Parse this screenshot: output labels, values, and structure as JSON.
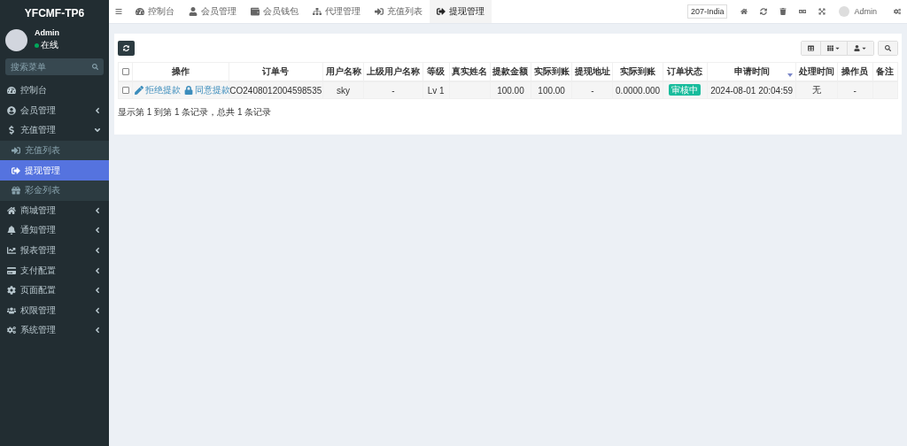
{
  "brand": "YFCMF-TP6",
  "user": {
    "name": "Admin",
    "status": "在线",
    "online": true
  },
  "search": {
    "placeholder": "搜索菜单"
  },
  "sidebar": {
    "items": [
      {
        "label": "控制台",
        "selected": false
      },
      {
        "label": "会员管理",
        "selected": false,
        "expanded": false
      },
      {
        "label": "充值管理",
        "selected": false,
        "expanded": true,
        "children": [
          {
            "label": "充值列表",
            "selected": false
          },
          {
            "label": "提现管理",
            "selected": true
          },
          {
            "label": "彩金列表",
            "selected": false
          }
        ]
      },
      {
        "label": "商城管理",
        "selected": false,
        "expanded": false
      },
      {
        "label": "通知管理",
        "selected": false,
        "expanded": false
      },
      {
        "label": "报表管理",
        "selected": false,
        "expanded": false
      },
      {
        "label": "支付配置",
        "selected": false,
        "expanded": false
      },
      {
        "label": "页面配置",
        "selected": false,
        "expanded": false
      },
      {
        "label": "权限管理",
        "selected": false,
        "expanded": false
      },
      {
        "label": "系统管理",
        "selected": false,
        "expanded": false
      }
    ]
  },
  "tabs": [
    {
      "label": "控制台",
      "selected": false
    },
    {
      "label": "会员管理",
      "selected": false
    },
    {
      "label": "会员钱包",
      "selected": false
    },
    {
      "label": "代理管理",
      "selected": false
    },
    {
      "label": "充值列表",
      "selected": false
    },
    {
      "label": "提现管理",
      "selected": true
    }
  ],
  "header": {
    "site_badge": "207-India",
    "admin": "Admin"
  },
  "table": {
    "select_all": false,
    "columns": [
      {
        "label": "操作",
        "sorted": false
      },
      {
        "label": "订单号",
        "sorted": false
      },
      {
        "label": "用户名称",
        "sorted": false
      },
      {
        "label": "上级用户名称",
        "sorted": false
      },
      {
        "label": "等级",
        "sorted": false
      },
      {
        "label": "真实姓名",
        "sorted": false
      },
      {
        "label": "提款金额",
        "sorted": false
      },
      {
        "label": "实际到账",
        "sorted": false
      },
      {
        "label": "提现地址",
        "sorted": false
      },
      {
        "label": "实际到账",
        "sorted": false
      },
      {
        "label": "订单状态",
        "sorted": false
      },
      {
        "label": "申请时间",
        "sorted": true
      },
      {
        "label": "处理时间",
        "sorted": false
      },
      {
        "label": "操作员",
        "sorted": false
      },
      {
        "label": "备注",
        "sorted": false
      }
    ],
    "rows": [
      {
        "checked": false,
        "actions": [
          "拒绝提款",
          "同意提款"
        ],
        "order_no": "CO2408012004598535",
        "username": "sky",
        "parent": "-",
        "level": "Lv 1",
        "real_name": "",
        "amount": "100.00",
        "received": "100.00",
        "address": "-",
        "actual": "0.0000.000",
        "status": "审核中",
        "applied": "2024-08-01 20:04:59",
        "processed": "无",
        "operator": "-",
        "note": ""
      }
    ]
  },
  "pagination": "显示第 1 到第 1 条记录，总共 1 条记录"
}
